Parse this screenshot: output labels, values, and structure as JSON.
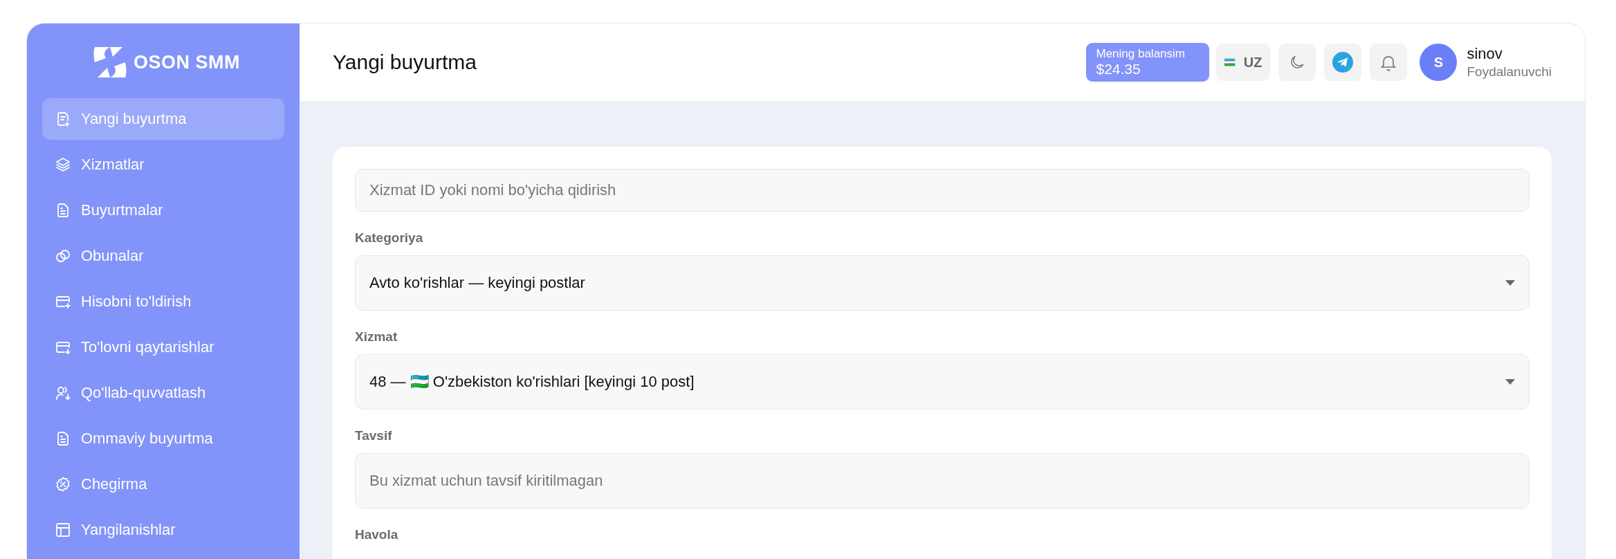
{
  "sidebar": {
    "logo_text": "OSON SMM",
    "items": [
      {
        "label": "Yangi buyurtma",
        "selected": true
      },
      {
        "label": "Xizmatlar",
        "selected": false
      },
      {
        "label": "Buyurtmalar",
        "selected": false
      },
      {
        "label": "Obunalar",
        "selected": false
      },
      {
        "label": "Hisobni to'ldirish",
        "selected": false
      },
      {
        "label": "To'lovni qaytarishlar",
        "selected": false
      },
      {
        "label": "Qo'llab-quvvatlash",
        "selected": false
      },
      {
        "label": "Ommaviy buyurtma",
        "selected": false
      },
      {
        "label": "Chegirma",
        "selected": false
      },
      {
        "label": "Yangilanishlar",
        "selected": false
      }
    ]
  },
  "header": {
    "title": "Yangi buyurtma",
    "balance": {
      "label": "Mening balansim",
      "amount": "$24.35"
    },
    "language": "UZ",
    "user": {
      "initial": "S",
      "name": "sinov",
      "role": "Foydalanuvchi"
    }
  },
  "form": {
    "search": {
      "placeholder": "Xizmat ID yoki nomi bo'yicha qidirish"
    },
    "fields": [
      {
        "kind": "select",
        "label": "Kategoriya",
        "value": "Avto ko'rishlar — keyingi postlar"
      },
      {
        "kind": "select",
        "label": "Xizmat",
        "value": "48 — 🇺🇿  O'zbekiston ko'rishlari [keyingi 10 post]"
      },
      {
        "kind": "text",
        "label": "Tavsif",
        "placeholder": "Bu xizmat uchun tavsif kiritilmagan"
      },
      {
        "kind": "label",
        "label": "Havola"
      }
    ]
  }
}
